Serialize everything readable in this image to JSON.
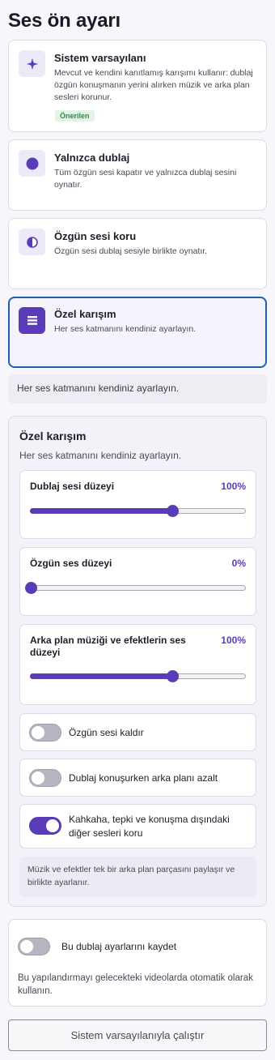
{
  "page": {
    "title": "Ses ön ayarı"
  },
  "presets": [
    {
      "title": "Sistem varsayılanı",
      "description": "Mevcut ve kendini kanıtlamış karışımı kullanır: dublaj özgün konuşmanın yerini alırken müzik ve arka plan sesleri korunur.",
      "badge": "Önerilen",
      "icon": "sparkle-icon",
      "selected": false
    },
    {
      "title": "Yalnızca dublaj",
      "description": "Tüm özgün sesi kapatır ve yalnızca dublaj sesini oynatır.",
      "icon": "filled-circle-icon",
      "selected": false
    },
    {
      "title": "Özgün sesi koru",
      "description": "Özgün sesi dublaj sesiyle birlikte oynatır.",
      "icon": "half-circle-icon",
      "selected": false
    },
    {
      "title": "Özel karışım",
      "description": "Her ses katmanını kendiniz ayarlayın.",
      "icon": "stack-icon",
      "selected": true
    }
  ],
  "selected_info": "Her ses katmanını kendiniz ayarlayın.",
  "custom": {
    "title": "Özel karışım",
    "subtitle": "Her ses katmanını kendiniz ayarlayın.",
    "sliders": [
      {
        "label": "Dublaj sesi düzeyi",
        "value": "100%",
        "fraction": 0.66
      },
      {
        "label": "Özgün ses düzeyi",
        "value": "0%",
        "fraction": 0.0
      },
      {
        "label": "Arka plan müziği ve efektlerin ses düzeyi",
        "value": "100%",
        "fraction": 0.66
      }
    ],
    "toggles": [
      {
        "label": "Özgün sesi kaldır",
        "on": false
      },
      {
        "label": "Dublaj konuşurken arka planı azalt",
        "on": false
      },
      {
        "label": "Kahkaha, tepki ve konuşma dışındaki diğer sesleri koru",
        "on": true
      }
    ],
    "note": "Müzik ve efektler tek bir arka plan parçasını paylaşır ve birlikte ayarlanır."
  },
  "save": {
    "label": "Bu dublaj ayarlarını kaydet",
    "on": false,
    "description": "Bu yapılandırmayı gelecekteki videolarda otomatik olarak kullanın."
  },
  "run_button": "Sistem varsayılanıyla çalıştır",
  "colors": {
    "accent": "#5b3cb8",
    "selected_border": "#1f5fb0",
    "badge_bg": "#e4f5e7",
    "badge_text": "#2f8a44"
  }
}
